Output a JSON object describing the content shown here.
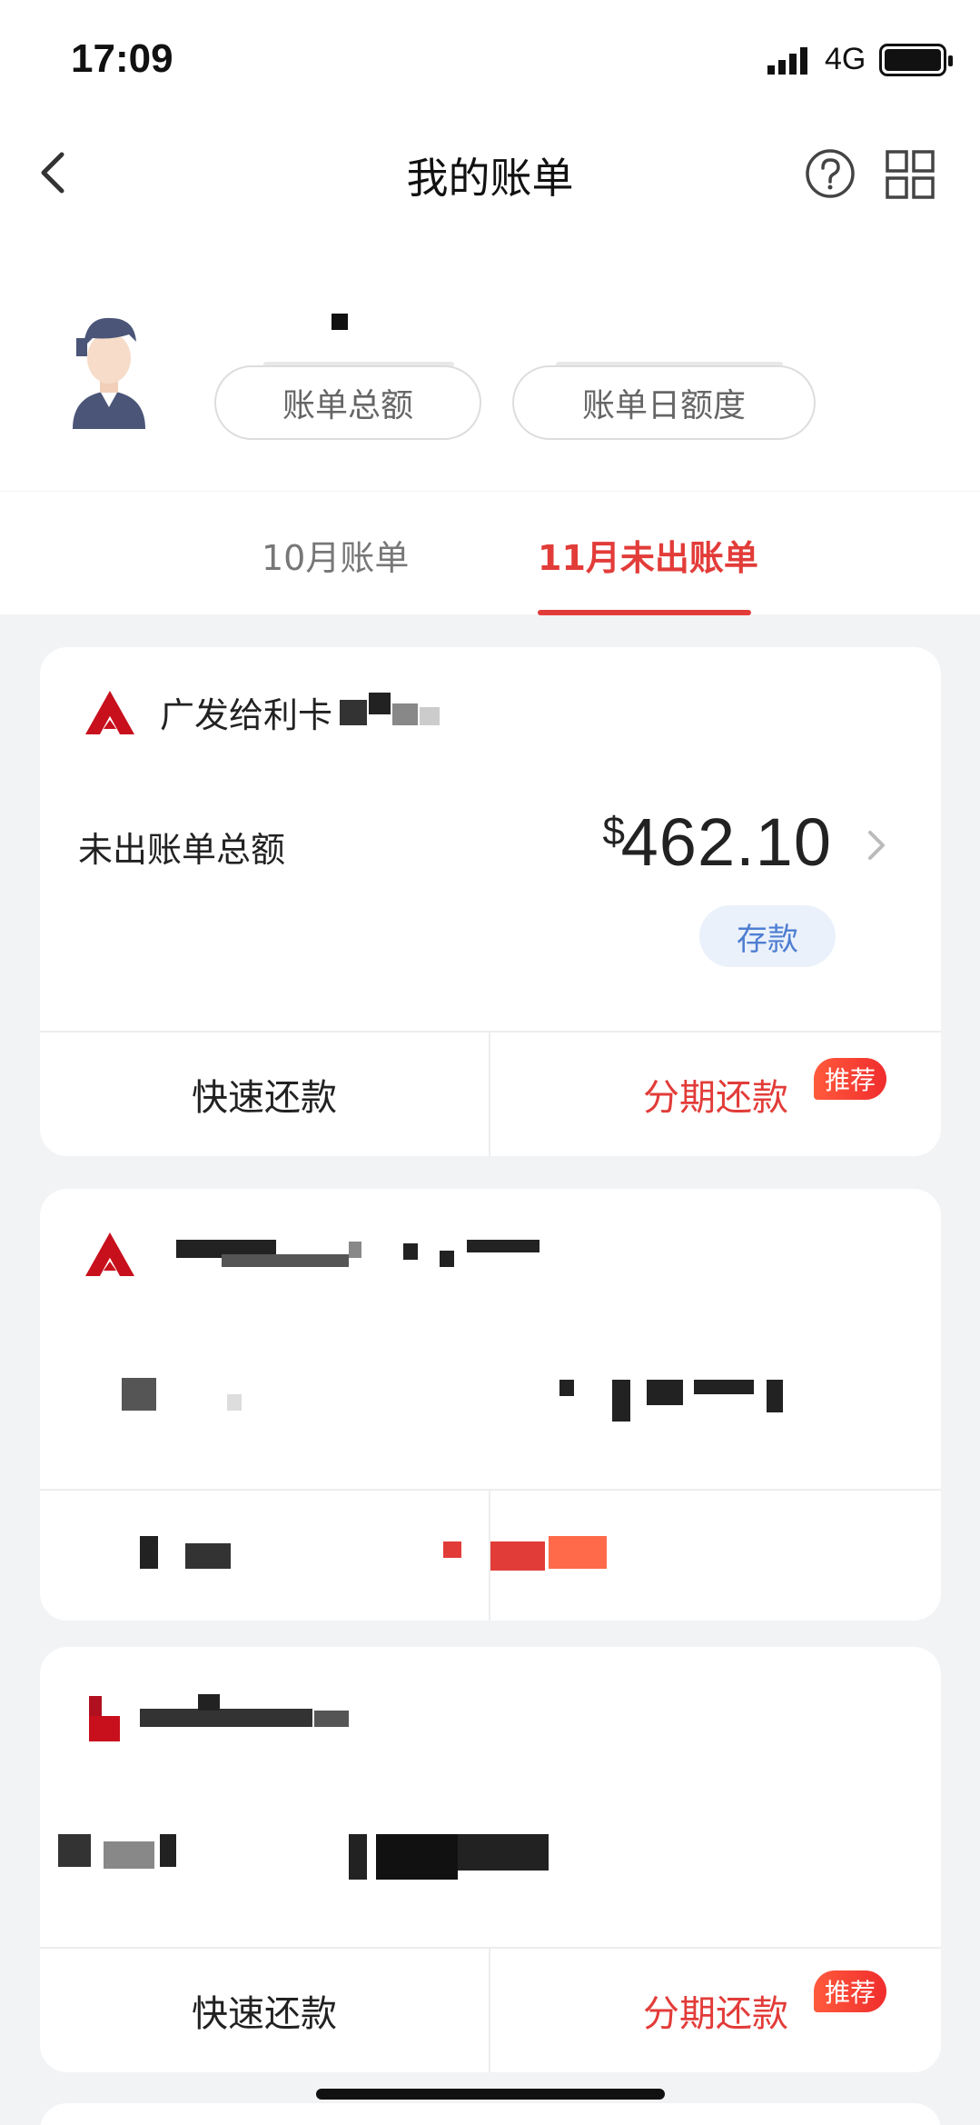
{
  "status_bar": {
    "time": "17:09",
    "network": "4G"
  },
  "nav": {
    "title": "我的账单"
  },
  "profile": {
    "total_bill_label": "账单总额",
    "daily_limit_label": "账单日额度"
  },
  "tabs": [
    {
      "label": "10月账单",
      "active": false
    },
    {
      "label": "11月未出账单",
      "active": true
    }
  ],
  "cards": [
    {
      "bank_name": "广发给利卡",
      "total_label": "未出账单总额",
      "currency": "$",
      "amount": "462.10",
      "deposit_label": "存款",
      "quick_repay": "快速还款",
      "installment": "分期还款",
      "recommend": "推荐"
    },
    {
      "quick_repay": "快速还款",
      "installment": "分期还款",
      "recommend": "推荐"
    }
  ],
  "colors": {
    "accent": "#e23c39",
    "deposit_blue": "#4f7ed2"
  }
}
